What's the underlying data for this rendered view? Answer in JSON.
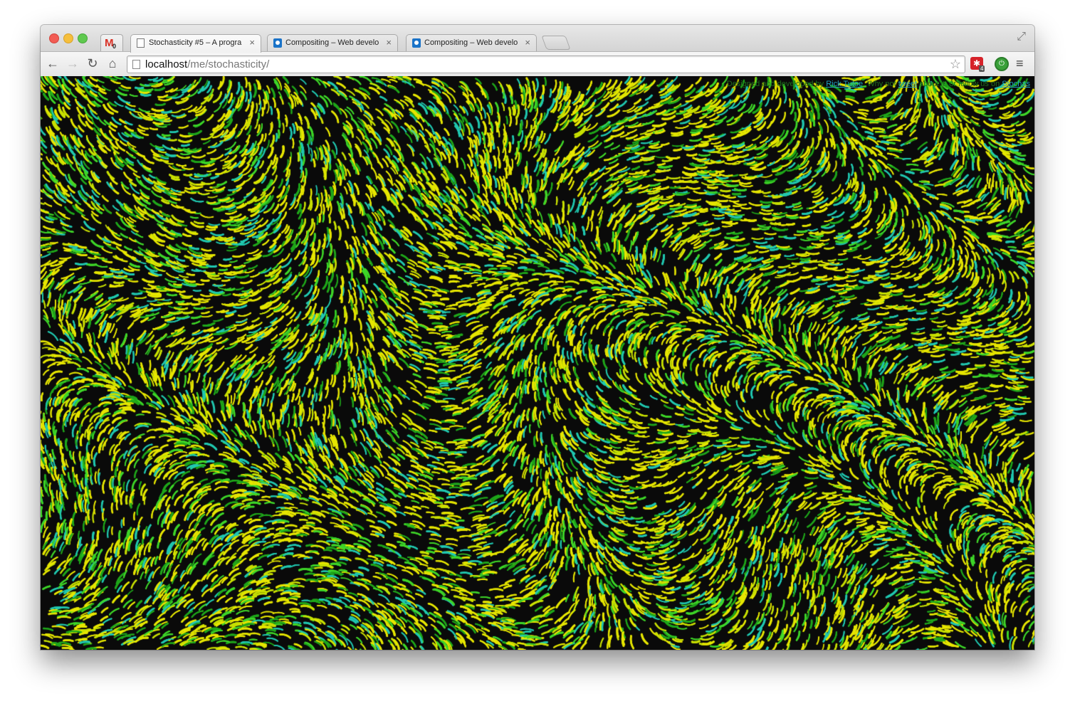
{
  "tabs": [
    {
      "title": "Stochasticity #5 – A progra",
      "icon": "page-icon",
      "active": true
    },
    {
      "title": "Compositing – Web develo",
      "icon": "mozilla-icon",
      "active": false
    },
    {
      "title": "Compositing – Web develo",
      "icon": "mozilla-icon",
      "active": false
    }
  ],
  "gmail": {
    "letter": "M",
    "count": "0"
  },
  "tab_close_glyph": "×",
  "nav": {
    "back": "←",
    "forward": "→",
    "reload": "↻",
    "home": "⌂"
  },
  "address": {
    "host": "localhost",
    "path": "/me/stochasticity/"
  },
  "extensions": {
    "red_badge": "4",
    "red_glyph": "✱",
    "green_glyph": "⏻"
  },
  "menu_glyph": "≡",
  "star_glyph": "☆",
  "fullscreen_glyph": "⤢",
  "credit": {
    "prefix": "Designed and developed by",
    "author": "Rick Tutoe",
    "middle": ". Why not",
    "link1": "tweet",
    "middle2": "about it, or follow us on",
    "link2": "Stochas"
  },
  "colors": {
    "background": "#0a0a0a",
    "primary": "#e6e600",
    "secondary": "#3ed628",
    "accent": "#20c8b0"
  }
}
